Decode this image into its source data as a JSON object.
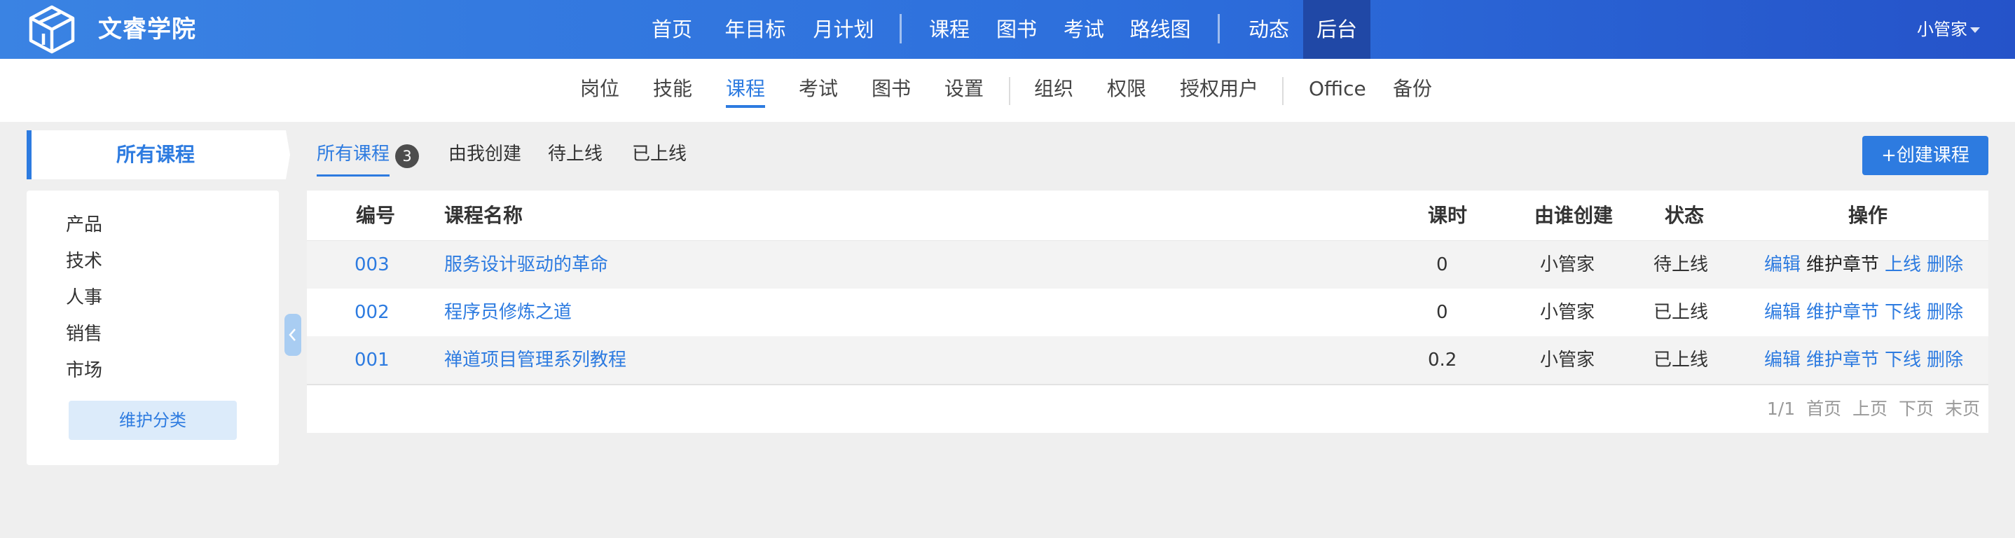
{
  "brand": {
    "name": "文睿学院",
    "logo_icon": "cube-logo-icon"
  },
  "main_nav": {
    "items": [
      "首页",
      "年目标",
      "月计划",
      "课程",
      "图书",
      "考试",
      "路线图",
      "动态",
      "后台"
    ],
    "active": "后台"
  },
  "user": {
    "name": "小管家"
  },
  "sub_nav": {
    "items": [
      "岗位",
      "技能",
      "课程",
      "考试",
      "图书",
      "设置",
      "组织",
      "权限",
      "授权用户",
      "Office",
      "备份"
    ],
    "active": "课程"
  },
  "sidebar": {
    "title": "所有课程",
    "categories": [
      "产品",
      "技术",
      "人事",
      "销售",
      "市场"
    ],
    "maintain_label": "维护分类"
  },
  "tabs": {
    "items": [
      "所有课程",
      "由我创建",
      "待上线",
      "已上线"
    ],
    "active": "所有课程",
    "count": "3"
  },
  "create_button": {
    "label": "+创建课程"
  },
  "table": {
    "headers": {
      "id": "编号",
      "name": "课程名称",
      "hours": "课时",
      "creator": "由谁创建",
      "status": "状态",
      "actions": "操作"
    },
    "rows": [
      {
        "id": "003",
        "name": "服务设计驱动的革命",
        "hours": "0",
        "creator": "小管家",
        "status": "待上线",
        "actions": [
          "编辑",
          "维护章节",
          "上线",
          "删除"
        ]
      },
      {
        "id": "002",
        "name": "程序员修炼之道",
        "hours": "0",
        "creator": "小管家",
        "status": "已上线",
        "actions": [
          "编辑",
          "维护章节",
          "下线",
          "删除"
        ]
      },
      {
        "id": "001",
        "name": "禅道项目管理系列教程",
        "hours": "0.2",
        "creator": "小管家",
        "status": "已上线",
        "actions": [
          "编辑",
          "维护章节",
          "下线",
          "删除"
        ]
      }
    ]
  },
  "pager": {
    "summary": "1/1",
    "first": "首页",
    "prev": "上页",
    "next": "下页",
    "last": "末页"
  },
  "colors": {
    "accent": "#2d7be0",
    "header_start": "#3a83e3",
    "header_end": "#2553c9"
  }
}
